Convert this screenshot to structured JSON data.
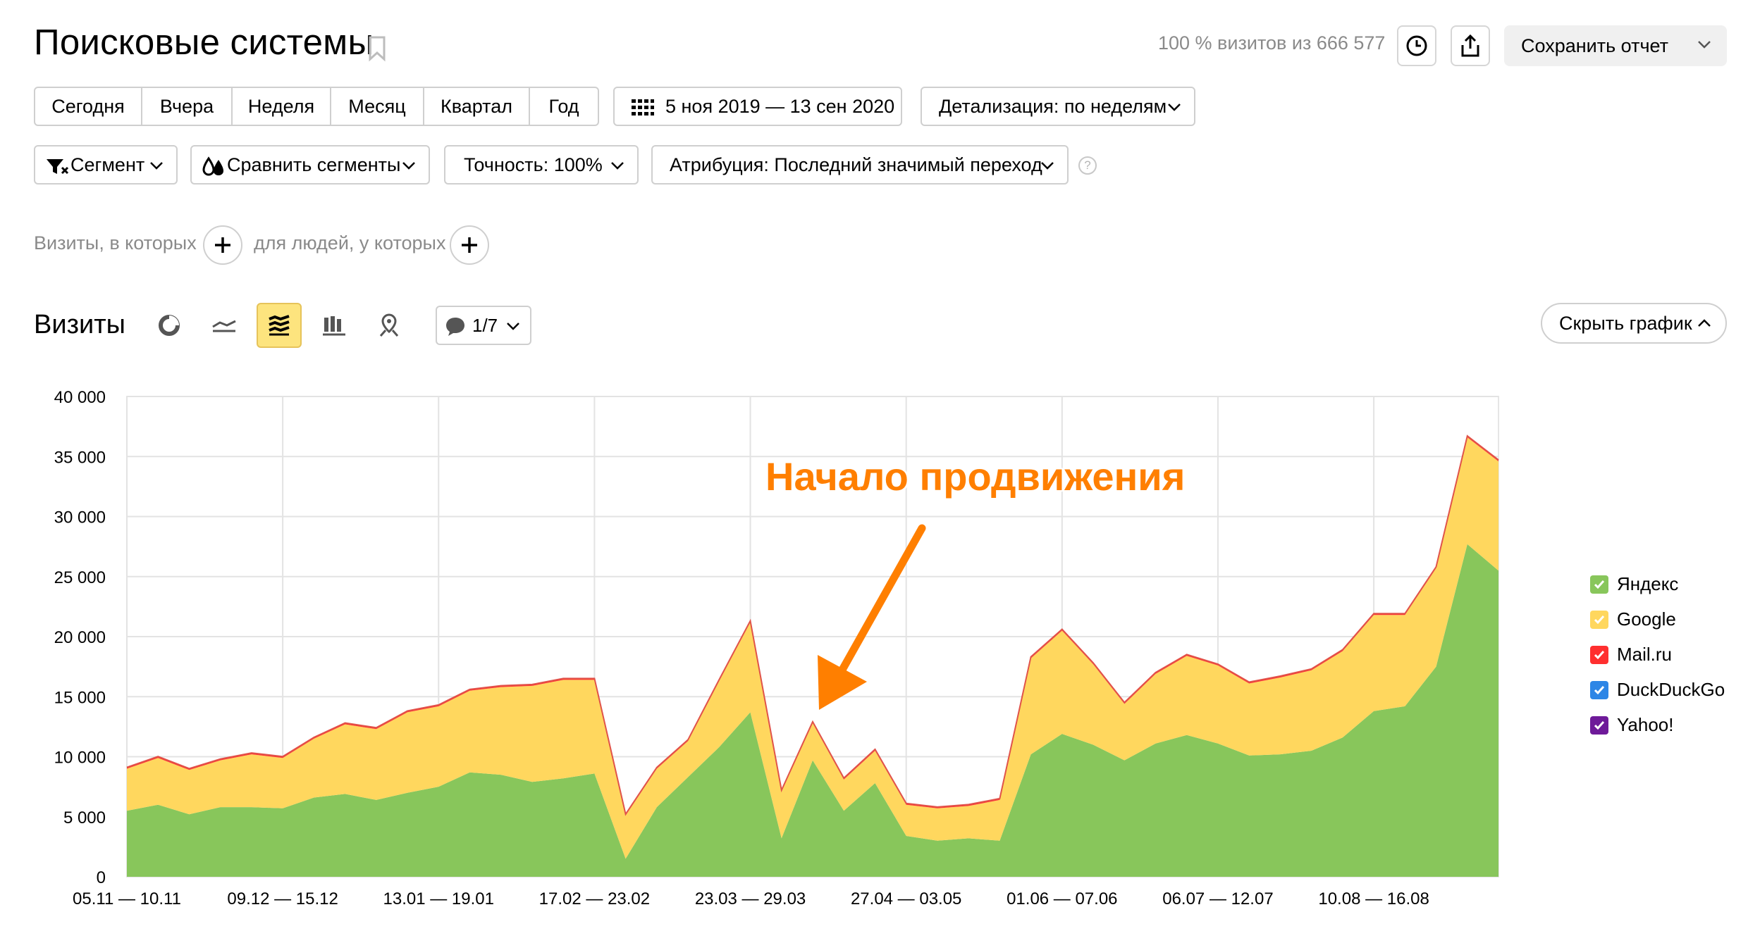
{
  "header": {
    "title": "Поисковые системы",
    "visits_info": "100 % визитов из 666 577",
    "save_label": "Сохранить отчет"
  },
  "periods": [
    "Сегодня",
    "Вчера",
    "Неделя",
    "Месяц",
    "Квартал",
    "Год"
  ],
  "date_range": "5 ноя 2019 — 13 сен 2020",
  "detail_label": "Детализация: по неделям",
  "toolbar": {
    "segment_label": "Сегмент",
    "compare_label": "Сравнить сегменты",
    "accuracy_label": "Точность: 100%",
    "attribution_label": "Атрибуция: Последний значимый переход",
    "help": "?"
  },
  "filters": {
    "visits_label": "Визиты, в которых",
    "people_label": "для людей, у которых"
  },
  "chart_header": {
    "title": "Визиты",
    "notes_label": "1/7",
    "hide_label": "Скрыть график"
  },
  "annotation": "Начало продвижения",
  "colors": {
    "yandex": "#88c65b",
    "google": "#ffd75e",
    "mailru": "#ff2f2f",
    "duckduckgo": "#2d86e6",
    "yahoo": "#6e1a99",
    "accent": "#fde47e",
    "annotation": "#ff7f00"
  },
  "chart_data": {
    "type": "area",
    "stacked": true,
    "ylim": [
      0,
      40000
    ],
    "yticks": [
      "0",
      "5 000",
      "10 000",
      "15 000",
      "20 000",
      "25 000",
      "30 000",
      "35 000",
      "40 000"
    ],
    "xtick_labels": [
      "05.11 — 10.11",
      "09.12 — 15.12",
      "13.01 — 19.01",
      "17.02 — 23.02",
      "23.03 — 29.03",
      "27.04 — 03.05",
      "01.06 — 07.06",
      "06.07 — 12.07",
      "10.08 — 16.08"
    ],
    "grid": true,
    "legend_position": "right",
    "series": [
      {
        "name": "Яндекс",
        "values": [
          5500,
          6000,
          5200,
          5800,
          5800,
          5700,
          6600,
          6900,
          6400,
          7000,
          7500,
          8700,
          8500,
          7900,
          8200,
          8600,
          1500,
          5800,
          8300,
          10800,
          13700,
          3200,
          9700,
          5500,
          7800,
          3400,
          3000,
          3200,
          3000,
          10200,
          11900,
          11000,
          9700,
          11100,
          11800,
          11100,
          10100,
          10200,
          10500,
          11600,
          13800,
          14200,
          17500,
          27700,
          25500
        ]
      },
      {
        "name": "Google",
        "values": [
          3500,
          3900,
          3700,
          3900,
          4400,
          4200,
          4900,
          5800,
          5900,
          6700,
          6700,
          6800,
          7300,
          8000,
          8200,
          7800,
          3600,
          3200,
          3000,
          5500,
          7500,
          3900,
          3100,
          2600,
          2700,
          2600,
          2700,
          2700,
          3400,
          8000,
          8600,
          6700,
          4700,
          5800,
          6600,
          6500,
          6000,
          6400,
          6700,
          7200,
          8000,
          7600,
          8200,
          8900,
          9100
        ]
      },
      {
        "name": "Mail.ru",
        "values": [
          100,
          100,
          100,
          100,
          100,
          100,
          100,
          100,
          100,
          100,
          100,
          100,
          100,
          100,
          100,
          100,
          100,
          100,
          100,
          100,
          100,
          100,
          100,
          100,
          100,
          100,
          100,
          100,
          100,
          100,
          100,
          100,
          100,
          100,
          100,
          100,
          100,
          100,
          100,
          100,
          100,
          100,
          100,
          100,
          100
        ]
      },
      {
        "name": "DuckDuckGo",
        "values": [
          10,
          10,
          10,
          10,
          10,
          10,
          10,
          10,
          10,
          10,
          10,
          10,
          10,
          10,
          10,
          10,
          10,
          10,
          10,
          10,
          10,
          10,
          10,
          10,
          10,
          10,
          10,
          10,
          10,
          10,
          10,
          10,
          10,
          10,
          10,
          10,
          10,
          10,
          10,
          10,
          10,
          10,
          10,
          10,
          10
        ]
      },
      {
        "name": "Yahoo!",
        "values": [
          5,
          5,
          5,
          5,
          5,
          5,
          5,
          5,
          5,
          5,
          5,
          5,
          5,
          5,
          5,
          5,
          5,
          5,
          5,
          5,
          5,
          5,
          5,
          5,
          5,
          5,
          5,
          5,
          5,
          5,
          5,
          5,
          5,
          5,
          5,
          5,
          5,
          5,
          5,
          5,
          5,
          5,
          5,
          5,
          5
        ]
      }
    ]
  }
}
